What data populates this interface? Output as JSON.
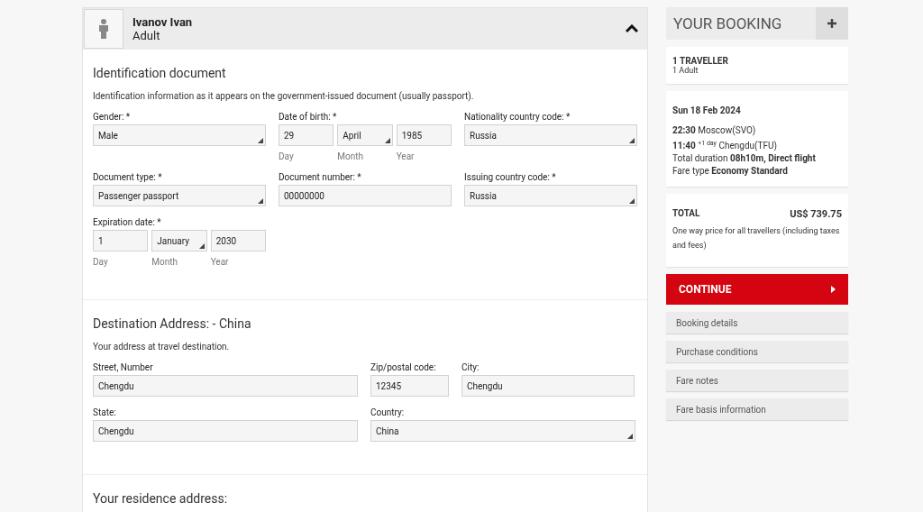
{
  "traveller": {
    "name": "Ivanov  Ivan",
    "type": "Adult",
    "expanded": true
  },
  "sections": [
    {
      "title": "Identification document",
      "note": "Identification information as it appears on the government-issued document (usually passport).",
      "rows": [
        [
          {
            "label": "Gender: *",
            "parts": [
              {
                "value": "Male",
                "kind": "select"
              }
            ]
          },
          {
            "label": "Date of birth: *",
            "parts": [
              {
                "value": "29",
                "kind": "text",
                "caption": "Day"
              },
              {
                "value": "April",
                "kind": "select",
                "caption": "Month"
              },
              {
                "value": "1985",
                "kind": "text",
                "caption": "Year"
              }
            ]
          },
          {
            "label": "Nationality country code: *",
            "parts": [
              {
                "value": "Russia",
                "kind": "select"
              }
            ]
          }
        ],
        [
          {
            "label": "Document type: *",
            "parts": [
              {
                "value": "Passenger passport",
                "kind": "select"
              }
            ]
          },
          {
            "label": "Document number: *",
            "parts": [
              {
                "value": "00000000",
                "kind": "text"
              }
            ]
          },
          {
            "label": "Issuing country code: *",
            "parts": [
              {
                "value": "Russia",
                "kind": "select"
              }
            ]
          }
        ],
        [
          {
            "label": "Expiration date: *",
            "parts": [
              {
                "value": "1",
                "kind": "text",
                "caption": "Day"
              },
              {
                "value": "January",
                "kind": "select",
                "caption": "Month"
              },
              {
                "value": "2030",
                "kind": "text",
                "caption": "Year"
              }
            ]
          }
        ]
      ]
    },
    {
      "title": "Destination Address: - China",
      "note": "Your address at travel destination.",
      "rows": [
        [
          {
            "label": "Street, Number",
            "parts": [
              {
                "value": "Chengdu",
                "kind": "text"
              }
            ]
          },
          {
            "label": "Zip/postal code:",
            "parts": [
              {
                "value": "12345",
                "kind": "text"
              }
            ]
          },
          {
            "label": "City:",
            "parts": [
              {
                "value": "Chengdu",
                "kind": "text"
              }
            ]
          }
        ],
        [
          {
            "label": "State:",
            "parts": [
              {
                "value": "Chengdu",
                "kind": "text"
              }
            ]
          },
          {
            "label": "Country:",
            "parts": [
              {
                "value": "China",
                "kind": "select"
              }
            ]
          }
        ]
      ]
    },
    {
      "title": "Your residence address:"
    }
  ],
  "booking": {
    "title": "YOUR BOOKING",
    "travellers": {
      "title": "1 TRAVELLER",
      "detail": "1 Adult"
    },
    "flight": {
      "date": "Sun 18 Feb 2024",
      "lines": [
        "**22:30** Moscow(SVO)",
        "**11:40** $^{+1 day}$ Chengdu(TFU)",
        "Total duration **08h10m, Direct flight**",
        "Fare type **Economy Standard**"
      ]
    },
    "total": {
      "label": "TOTAL",
      "amount": "US$ 739.75",
      "note": "One way price for all travellers (including taxes and fees)"
    },
    "continue": "CONTINUE",
    "links": [
      "Booking details",
      "Purchase conditions",
      "Fare notes",
      "Fare basis information"
    ]
  }
}
